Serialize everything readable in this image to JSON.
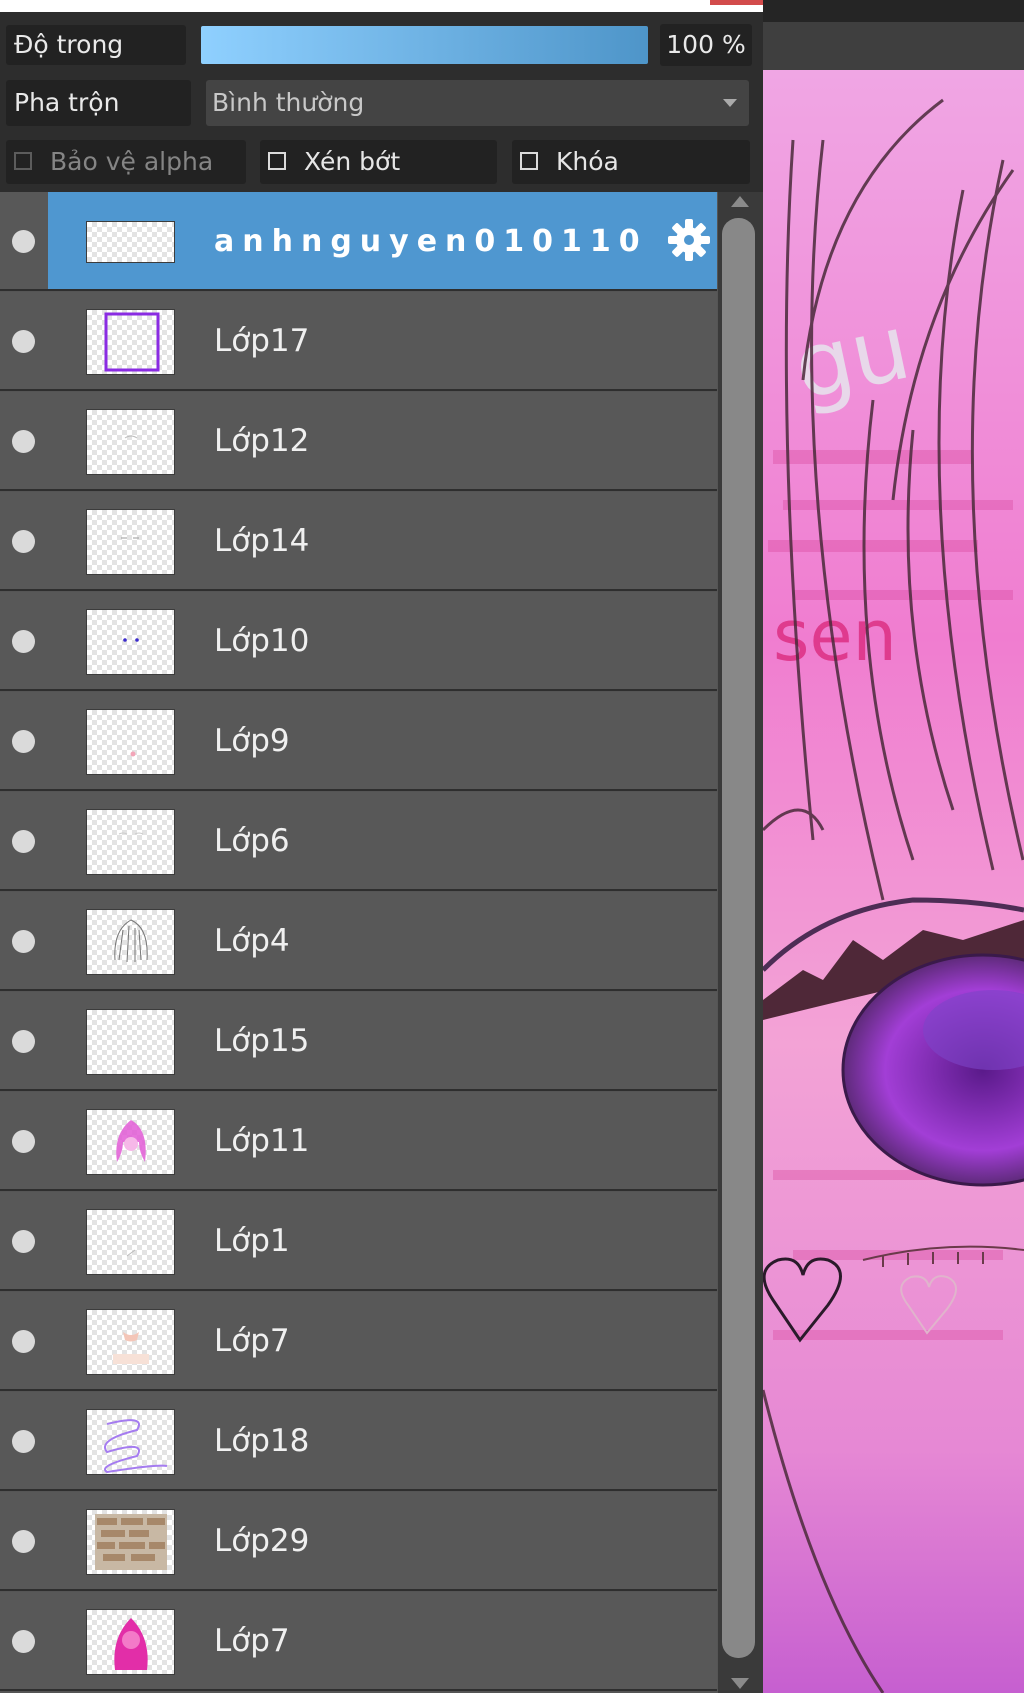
{
  "controls": {
    "opacity_label": "Độ trong",
    "opacity_value": "100 %",
    "opacity_fraction": 1.0,
    "blend_label": "Pha trộn",
    "blend_mode": "Bình thường",
    "protect_alpha_label": "Bảo vệ alpha",
    "clip_label": "Xén bớt",
    "lock_label": "Khóa"
  },
  "layers": [
    {
      "name": "anhnguyen010110",
      "selected": true
    },
    {
      "name": "Lớp17"
    },
    {
      "name": "Lớp12"
    },
    {
      "name": "Lớp14"
    },
    {
      "name": "Lớp10"
    },
    {
      "name": "Lớp9"
    },
    {
      "name": "Lớp6"
    },
    {
      "name": "Lớp4"
    },
    {
      "name": "Lớp15"
    },
    {
      "name": "Lớp11"
    },
    {
      "name": "Lớp1"
    },
    {
      "name": "Lớp7"
    },
    {
      "name": "Lớp18"
    },
    {
      "name": "Lớp29"
    },
    {
      "name": "Lớp7"
    }
  ],
  "icons": {
    "visibility": "visibility-dot-icon",
    "settings": "gear-icon",
    "scroll_up": "scroll-up-arrow-icon",
    "scroll_down": "scroll-down-arrow-icon",
    "dropdown": "chevron-down-icon"
  },
  "colors": {
    "selected_row": "#4f97d0",
    "row": "#585858",
    "opacity_bar_start": "#8fd0ff",
    "opacity_bar_end": "#4e95c9"
  }
}
